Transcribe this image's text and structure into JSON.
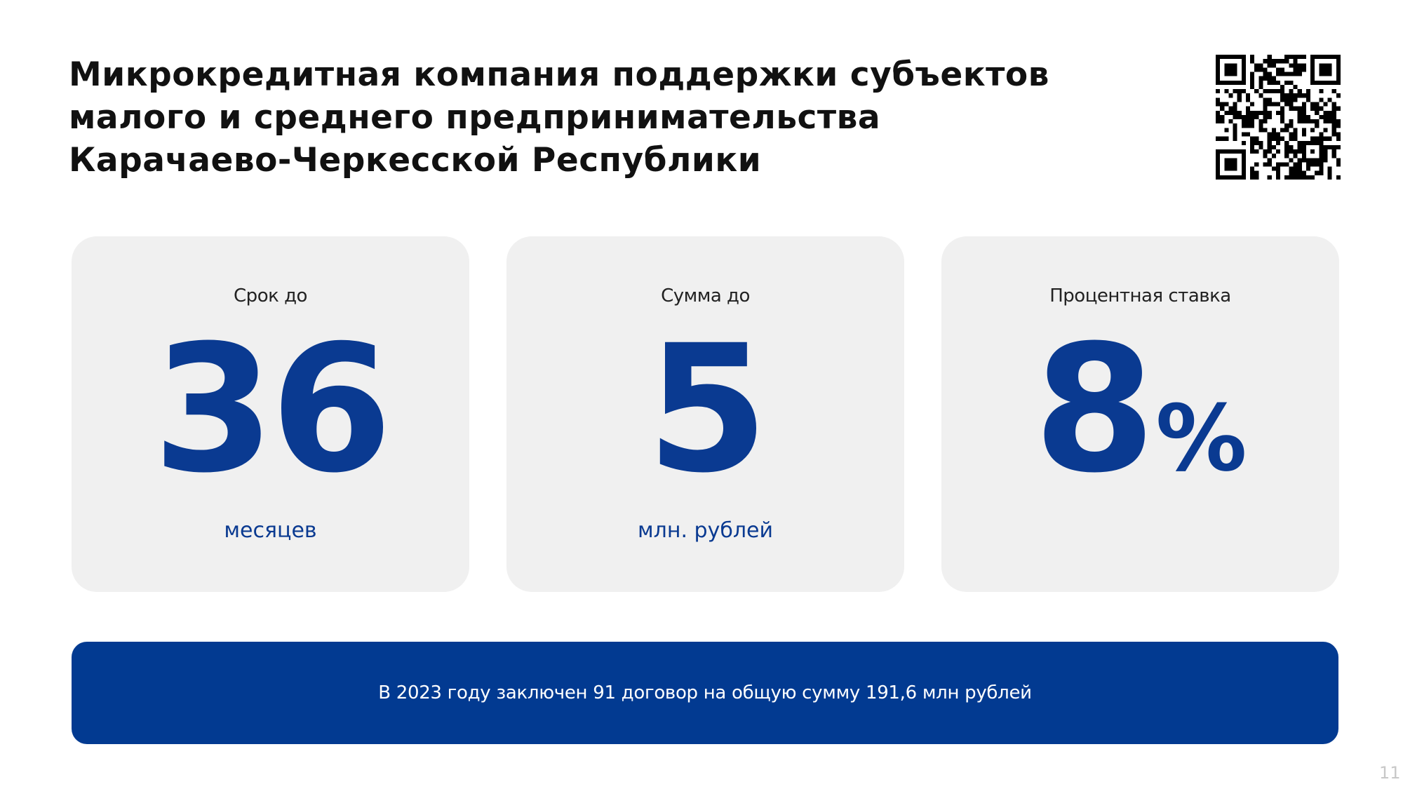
{
  "title": {
    "line1": "Микрокредитная компания поддержки субъектов",
    "line2": "малого и среднего предпринимательства",
    "line3": "Карачаево-Черкесской Республики"
  },
  "qr_code": {
    "icon": "qr-code-icon"
  },
  "cards": [
    {
      "label": "Срок до",
      "value": "36",
      "suffix": "",
      "unit": "месяцев"
    },
    {
      "label": "Сумма до",
      "value": "5",
      "suffix": "",
      "unit": "млн. рублей"
    },
    {
      "label": "Процентная ставка",
      "value": "8",
      "suffix": "%",
      "unit": ""
    }
  ],
  "banner": {
    "text": "В 2023 году заключен 91 договор на общую сумму 191,6 млн рублей"
  },
  "page_number": "11",
  "colors": {
    "accent": "#0a3a91",
    "banner_bg": "#023a91",
    "card_bg": "#f0f0f0",
    "title": "#111111"
  }
}
